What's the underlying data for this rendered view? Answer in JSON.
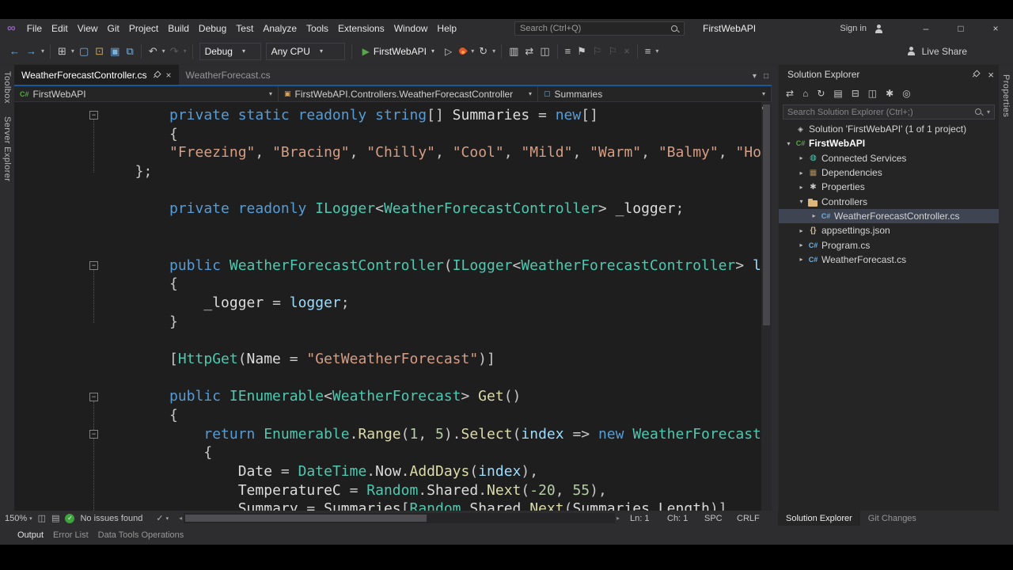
{
  "colors": {
    "accent": "#007acc",
    "run_green": "#57a64a",
    "flame_orange": "#e0562e",
    "ok_green": "#3fa33f",
    "folder_tan": "#dcb67a",
    "selection": "#3e4452",
    "syntax": {
      "kw": "#569cd6",
      "ty": "#4ec9b0",
      "st": "#d69d85",
      "me": "#dcdcaa",
      "id": "#dcdcdc",
      "pa": "#9cdcfe",
      "nu": "#b5cea8",
      "pu": "#c8c8c8"
    }
  },
  "titlebar": {
    "menus": [
      "File",
      "Edit",
      "View",
      "Git",
      "Project",
      "Build",
      "Debug",
      "Test",
      "Analyze",
      "Tools",
      "Extensions",
      "Window",
      "Help"
    ],
    "search_placeholder": "Search (Ctrl+Q)",
    "solution_badge": "FirstWebAPI",
    "sign_in": "Sign in",
    "window_buttons": {
      "minimize": "–",
      "maximize": "□",
      "close": "×"
    }
  },
  "toolbar": {
    "config": "Debug",
    "platform": "Any CPU",
    "run_target": "FirstWebAPI",
    "live_share": "Live Share",
    "groups": {
      "a": [
        {
          "name": "navigate-backward-icon",
          "glyph": "←",
          "color": "#6fb3e0"
        },
        {
          "name": "navigate-forward-icon",
          "glyph": "→",
          "color": "#6fb3e0",
          "caret": true
        },
        {
          "sep": true
        },
        {
          "name": "window-switch-icon",
          "glyph": "⊞",
          "caret": true
        },
        {
          "name": "new-file-icon",
          "glyph": "▢",
          "color": "#7ab0dc"
        },
        {
          "name": "open-file-icon",
          "glyph": "⊡",
          "color": "#c8a35c"
        },
        {
          "name": "save-icon",
          "glyph": "▣",
          "color": "#7ab0dc"
        },
        {
          "name": "save-all-icon",
          "glyph": "⧉",
          "color": "#7ab0dc"
        },
        {
          "sep": true
        },
        {
          "name": "undo-icon",
          "glyph": "↶",
          "caret": true
        },
        {
          "name": "redo-icon",
          "glyph": "↷",
          "disabled": true,
          "caret": true
        },
        {
          "sep": true
        }
      ],
      "b": [
        {
          "sep": true
        },
        {
          "name": "profiler-icon",
          "glyph": "▥"
        },
        {
          "name": "find-in-files-icon",
          "glyph": "⇄"
        },
        {
          "name": "code-map-icon",
          "glyph": "◫"
        },
        {
          "sep": true
        },
        {
          "name": "line-operations-icon",
          "glyph": "≡"
        },
        {
          "name": "bookmark-icon",
          "glyph": "⚑"
        },
        {
          "name": "previous-bookmark-icon",
          "glyph": "⚐",
          "disabled": true
        },
        {
          "name": "next-bookmark-icon",
          "glyph": "⚐",
          "disabled": true
        },
        {
          "name": "clear-bookmarks-icon",
          "glyph": "×",
          "disabled": true
        },
        {
          "sep": true
        },
        {
          "name": "toolbar-options-icon",
          "glyph": "≡",
          "caret": true
        }
      ]
    }
  },
  "document_tabs": [
    {
      "label": "WeatherForecastController.cs",
      "active": true
    },
    {
      "label": "WeatherForecast.cs",
      "active": false
    }
  ],
  "tabstrip_icons": [
    {
      "name": "active-files-dropdown-icon",
      "glyph": "▾"
    },
    {
      "name": "float-tab-icon",
      "glyph": "□"
    }
  ],
  "navbar": {
    "segments": [
      {
        "label": "FirstWebAPI",
        "icon": "project"
      },
      {
        "label": "FirstWebAPI.Controllers.WeatherForecastController",
        "icon": "class"
      },
      {
        "label": "Summaries",
        "icon": "field"
      }
    ]
  },
  "editor": {
    "fold_ranges": [
      [
        0,
        3
      ],
      [
        8,
        11
      ],
      [
        15,
        21
      ]
    ],
    "lines": [
      {
        "indent": 0,
        "fold": true,
        "tokens": [
          [
            "kw",
            "private "
          ],
          [
            "kw",
            "static "
          ],
          [
            "kw",
            "readonly "
          ],
          [
            "kw",
            "string"
          ],
          [
            "pu",
            "[] "
          ],
          [
            "id",
            "Summaries "
          ],
          [
            "pu",
            "= "
          ],
          [
            "kw",
            "new"
          ],
          [
            "pu",
            "[]"
          ]
        ]
      },
      {
        "indent": 0,
        "tokens": [
          [
            "pu",
            "{"
          ]
        ]
      },
      {
        "indent": 0,
        "tokens": [
          [
            "st",
            "\"Freezing\""
          ],
          [
            "pu",
            ", "
          ],
          [
            "st",
            "\"Bracing\""
          ],
          [
            "pu",
            ", "
          ],
          [
            "st",
            "\"Chilly\""
          ],
          [
            "pu",
            ", "
          ],
          [
            "st",
            "\"Cool\""
          ],
          [
            "pu",
            ", "
          ],
          [
            "st",
            "\"Mild\""
          ],
          [
            "pu",
            ", "
          ],
          [
            "st",
            "\"Warm\""
          ],
          [
            "pu",
            ", "
          ],
          [
            "st",
            "\"Balmy\""
          ],
          [
            "pu",
            ", "
          ],
          [
            "st",
            "\"Hot\""
          ]
        ]
      },
      {
        "indent": -4,
        "tokens": [
          [
            "pu",
            "};"
          ]
        ]
      },
      {
        "indent": 0,
        "tokens": []
      },
      {
        "indent": 0,
        "tokens": [
          [
            "kw",
            "private "
          ],
          [
            "kw",
            "readonly "
          ],
          [
            "ty",
            "ILogger"
          ],
          [
            "pu",
            "<"
          ],
          [
            "ty",
            "WeatherForecastController"
          ],
          [
            "pu",
            "> "
          ],
          [
            "id",
            "_logger"
          ],
          [
            "pu",
            ";"
          ]
        ]
      },
      {
        "indent": 0,
        "tokens": []
      },
      {
        "indent": 0,
        "tokens": []
      },
      {
        "indent": 0,
        "fold": true,
        "tokens": [
          [
            "kw",
            "public "
          ],
          [
            "ty",
            "WeatherForecastController"
          ],
          [
            "pu",
            "("
          ],
          [
            "ty",
            "ILogger"
          ],
          [
            "pu",
            "<"
          ],
          [
            "ty",
            "WeatherForecastController"
          ],
          [
            "pu",
            "> "
          ],
          [
            "pa",
            "logger"
          ],
          [
            "pu",
            ")"
          ]
        ]
      },
      {
        "indent": 0,
        "tokens": [
          [
            "pu",
            "{"
          ]
        ]
      },
      {
        "indent": 4,
        "tokens": [
          [
            "id",
            "_logger "
          ],
          [
            "pu",
            "= "
          ],
          [
            "pa",
            "logger"
          ],
          [
            "pu",
            ";"
          ]
        ]
      },
      {
        "indent": 0,
        "tokens": [
          [
            "pu",
            "}"
          ]
        ]
      },
      {
        "indent": 0,
        "tokens": []
      },
      {
        "indent": 0,
        "tokens": [
          [
            "pu",
            "["
          ],
          [
            "ty",
            "HttpGet"
          ],
          [
            "pu",
            "("
          ],
          [
            "id",
            "Name "
          ],
          [
            "pu",
            "= "
          ],
          [
            "st",
            "\"GetWeatherForecast\""
          ],
          [
            "pu",
            ")]"
          ]
        ]
      },
      {
        "indent": 0,
        "tokens": []
      },
      {
        "indent": 0,
        "fold": true,
        "tokens": [
          [
            "kw",
            "public "
          ],
          [
            "ty",
            "IEnumerable"
          ],
          [
            "pu",
            "<"
          ],
          [
            "ty",
            "WeatherForecast"
          ],
          [
            "pu",
            "> "
          ],
          [
            "me",
            "Get"
          ],
          [
            "pu",
            "()"
          ]
        ]
      },
      {
        "indent": 0,
        "tokens": [
          [
            "pu",
            "{"
          ]
        ]
      },
      {
        "indent": 4,
        "fold": true,
        "tokens": [
          [
            "kw",
            "return "
          ],
          [
            "ty",
            "Enumerable"
          ],
          [
            "pu",
            "."
          ],
          [
            "me",
            "Range"
          ],
          [
            "pu",
            "("
          ],
          [
            "nu",
            "1"
          ],
          [
            "pu",
            ", "
          ],
          [
            "nu",
            "5"
          ],
          [
            "pu",
            ")."
          ],
          [
            "me",
            "Select"
          ],
          [
            "pu",
            "("
          ],
          [
            "pa",
            "index "
          ],
          [
            "pu",
            "=> "
          ],
          [
            "kw",
            "new "
          ],
          [
            "ty",
            "WeatherForecast"
          ]
        ]
      },
      {
        "indent": 4,
        "tokens": [
          [
            "pu",
            "{"
          ]
        ]
      },
      {
        "indent": 8,
        "tokens": [
          [
            "id",
            "Date "
          ],
          [
            "pu",
            "= "
          ],
          [
            "ty",
            "DateTime"
          ],
          [
            "pu",
            "."
          ],
          [
            "id",
            "Now"
          ],
          [
            "pu",
            "."
          ],
          [
            "me",
            "AddDays"
          ],
          [
            "pu",
            "("
          ],
          [
            "pa",
            "index"
          ],
          [
            "pu",
            "),"
          ]
        ]
      },
      {
        "indent": 8,
        "tokens": [
          [
            "id",
            "TemperatureC "
          ],
          [
            "pu",
            "= "
          ],
          [
            "ty",
            "Random"
          ],
          [
            "pu",
            "."
          ],
          [
            "id",
            "Shared"
          ],
          [
            "pu",
            "."
          ],
          [
            "me",
            "Next"
          ],
          [
            "pu",
            "("
          ],
          [
            "nu",
            "-20"
          ],
          [
            "pu",
            ", "
          ],
          [
            "nu",
            "55"
          ],
          [
            "pu",
            "),"
          ]
        ]
      },
      {
        "indent": 8,
        "tokens": [
          [
            "id",
            "Summary "
          ],
          [
            "pu",
            "= "
          ],
          [
            "id",
            "Summaries"
          ],
          [
            "pu",
            "["
          ],
          [
            "ty",
            "Random"
          ],
          [
            "pu",
            "."
          ],
          [
            "id",
            "Shared"
          ],
          [
            "pu",
            "."
          ],
          [
            "me",
            "Next"
          ],
          [
            "pu",
            "("
          ],
          [
            "id",
            "Summaries"
          ],
          [
            "pu",
            "."
          ],
          [
            "id",
            "Length"
          ],
          [
            "pu",
            ")]"
          ]
        ]
      }
    ]
  },
  "solution_explorer": {
    "title": "Solution Explorer",
    "search_placeholder": "Search Solution Explorer (Ctrl+;)",
    "toolbar_icons": [
      {
        "name": "sync-with-active-document-icon",
        "glyph": "⇄"
      },
      {
        "name": "home-icon",
        "glyph": "⌂"
      },
      {
        "name": "refresh-icon",
        "glyph": "↻"
      },
      {
        "name": "nest-files-icon",
        "glyph": "▤"
      },
      {
        "name": "collapse-all-icon",
        "glyph": "⊟"
      },
      {
        "name": "show-all-files-icon",
        "glyph": "◫"
      },
      {
        "name": "properties-icon",
        "glyph": "✱"
      },
      {
        "name": "preview-selected-items-icon",
        "glyph": "◎"
      }
    ],
    "tree": [
      {
        "level": 0,
        "arrow": "none",
        "icon": "solution",
        "label": "Solution 'FirstWebAPI' (1 of 1 project)"
      },
      {
        "level": 0,
        "arrow": "expanded",
        "icon": "csproj",
        "label": "FirstWebAPI",
        "bold": true
      },
      {
        "level": 1,
        "arrow": "collapsed",
        "icon": "connected-services",
        "label": "Connected Services"
      },
      {
        "level": 1,
        "arrow": "collapsed",
        "icon": "dependencies",
        "label": "Dependencies"
      },
      {
        "level": 1,
        "arrow": "collapsed",
        "icon": "properties-wrench",
        "label": "Properties"
      },
      {
        "level": 1,
        "arrow": "expanded",
        "icon": "folder",
        "label": "Controllers"
      },
      {
        "level": 2,
        "arrow": "collapsed",
        "icon": "csharp-file",
        "label": "WeatherForecastController.cs",
        "selected": true
      },
      {
        "level": 1,
        "arrow": "collapsed",
        "icon": "json-file",
        "label": "appsettings.json"
      },
      {
        "level": 1,
        "arrow": "collapsed",
        "icon": "csharp-file",
        "label": "Program.cs"
      },
      {
        "level": 1,
        "arrow": "collapsed",
        "icon": "csharp-file",
        "label": "WeatherForecast.cs"
      }
    ],
    "bottom_tabs": [
      {
        "label": "Solution Explorer",
        "active": true
      },
      {
        "label": "Git Changes",
        "active": false
      }
    ]
  },
  "statusbar": {
    "zoom": "150%",
    "issues": "No issues found",
    "ln": "Ln: 1",
    "ch": "Ch: 1",
    "spaces": "SPC",
    "eol": "CRLF"
  },
  "bottom_panel": {
    "tabs": [
      "Output",
      "Error List",
      "Data Tools Operations"
    ]
  },
  "rails": {
    "left": [
      "Toolbox",
      "Server Explorer"
    ],
    "right": [
      "Properties"
    ]
  }
}
